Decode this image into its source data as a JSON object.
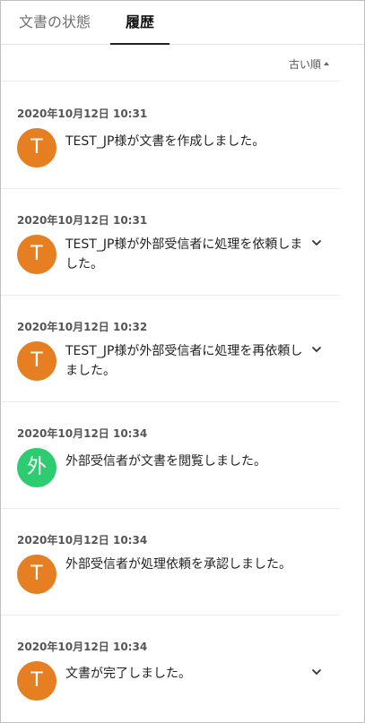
{
  "tabs": [
    {
      "label": "文書の状態"
    },
    {
      "label": "履歴"
    }
  ],
  "sort": {
    "label": "古い順"
  },
  "colors": {
    "orange": "#E67E22",
    "green": "#2ECC71"
  },
  "history": [
    {
      "timestamp": "2020年10月12日 10:31",
      "avatar": "T",
      "avatar_color": "#E67E22",
      "message": "TEST_JP様が文書を作成しました。",
      "expandable": false
    },
    {
      "timestamp": "2020年10月12日 10:31",
      "avatar": "T",
      "avatar_color": "#E67E22",
      "message": "TEST_JP様が外部受信者に処理を依頼しました。",
      "expandable": true
    },
    {
      "timestamp": "2020年10月12日 10:32",
      "avatar": "T",
      "avatar_color": "#E67E22",
      "message": "TEST_JP様が外部受信者に処理を再依頼しました。",
      "expandable": true
    },
    {
      "timestamp": "2020年10月12日 10:34",
      "avatar": "外",
      "avatar_color": "#2ECC71",
      "message": "外部受信者が文書を閲覧しました。",
      "expandable": false
    },
    {
      "timestamp": "2020年10月12日 10:34",
      "avatar": "T",
      "avatar_color": "#E67E22",
      "message": "外部受信者が処理依頼を承認しました。",
      "expandable": false
    },
    {
      "timestamp": "2020年10月12日 10:34",
      "avatar": "T",
      "avatar_color": "#E67E22",
      "message": "文書が完了しました。",
      "expandable": true
    }
  ]
}
